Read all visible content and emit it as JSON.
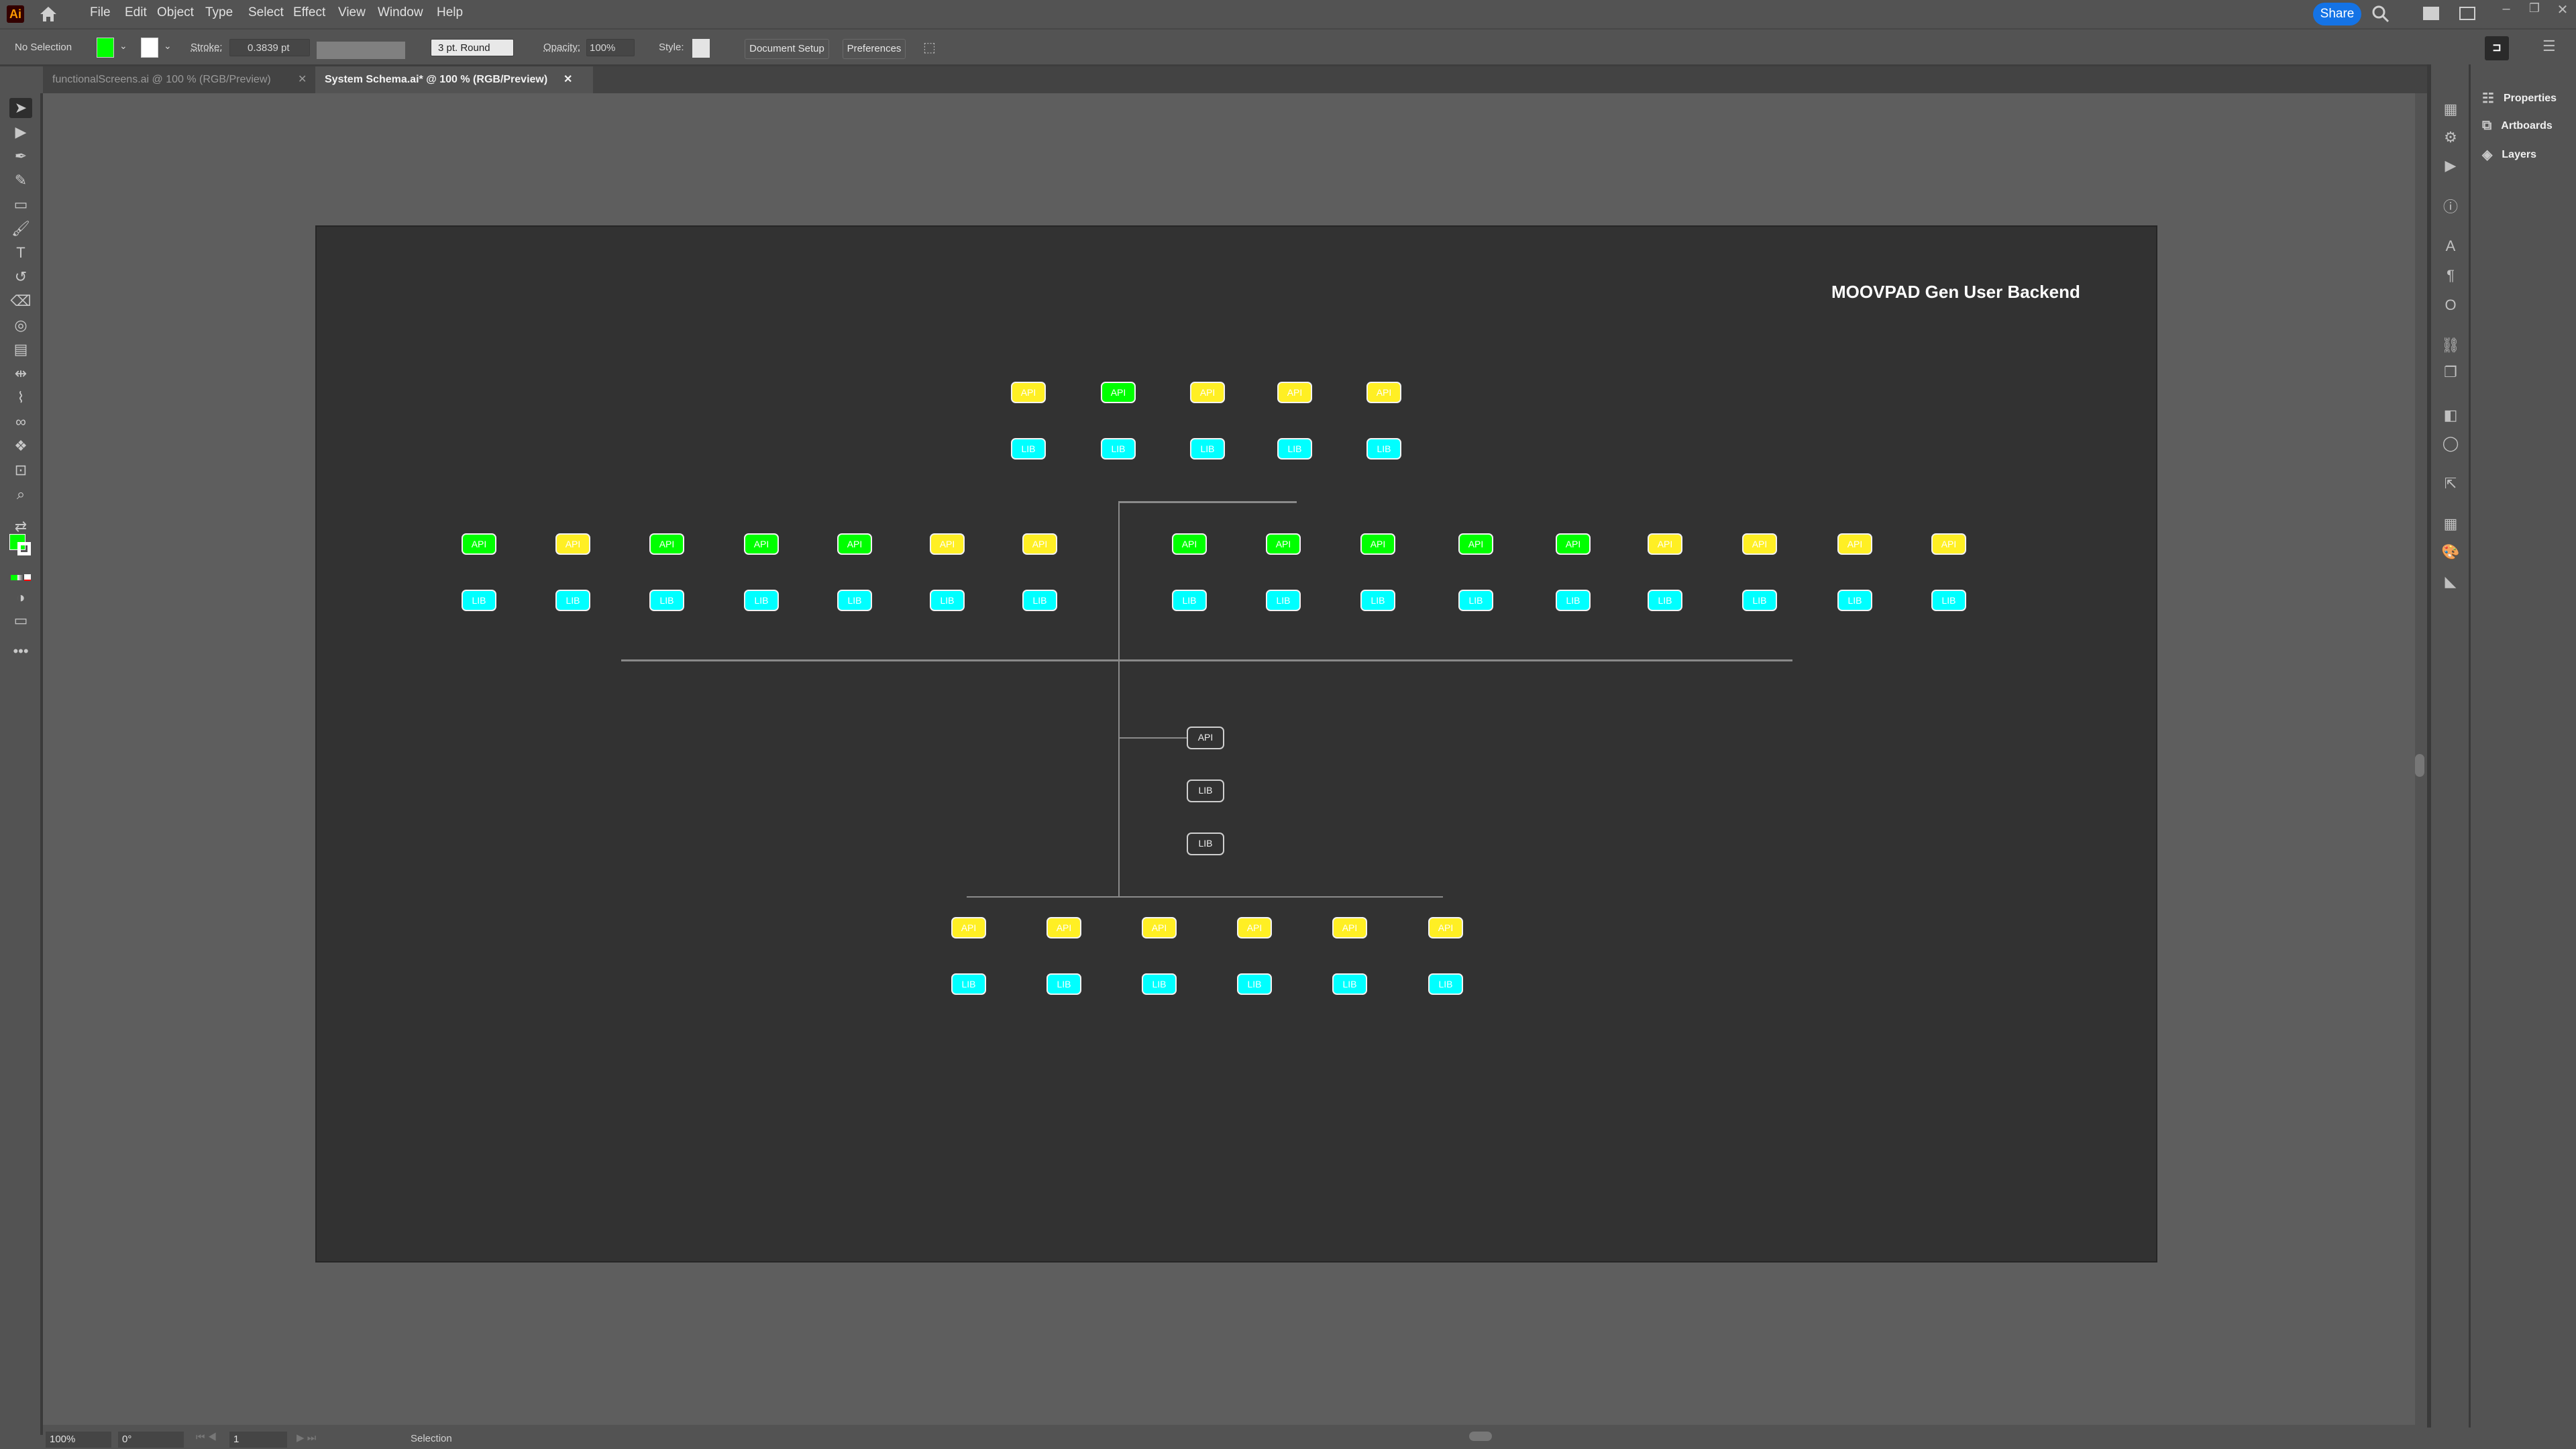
{
  "app": {
    "logo": "Ai",
    "share_label": "Share"
  },
  "menu": [
    "File",
    "Edit",
    "Object",
    "Type",
    "Select",
    "Effect",
    "View",
    "Window",
    "Help"
  ],
  "control_bar": {
    "selection_state": "No Selection",
    "fill_color": "#00ff00",
    "stroke_label": "Stroke:",
    "stroke_value": "0.3839 pt",
    "brush_label": "3 pt. Round",
    "opacity_label": "Opacity:",
    "opacity_value": "100%",
    "style_label": "Style:",
    "document_setup": "Document Setup",
    "preferences": "Preferences"
  },
  "tabs": [
    {
      "label": "functionalScreens.ai @ 100 % (RGB/Preview)",
      "active": false
    },
    {
      "label": "System Schema.ai* @ 100 % (RGB/Preview)",
      "active": true
    }
  ],
  "tools": [
    "selection",
    "direct-selection",
    "pen",
    "curvature",
    "rectangle",
    "paintbrush",
    "type",
    "rotate",
    "eraser",
    "shape-builder",
    "gradient",
    "width",
    "eyedropper",
    "blend",
    "symbol-sprayer",
    "artboard",
    "zoom"
  ],
  "right_panels": [
    "Properties",
    "Artboards",
    "Layers"
  ],
  "artboard": {
    "title": "MOOVPAD Gen User Backend",
    "colors": {
      "green": "#00ff00",
      "yellow": "#ffef24",
      "cyan": "#00ffff",
      "background": "#323232"
    },
    "top_group": {
      "api": [
        "yellow",
        "green",
        "yellow",
        "yellow",
        "yellow"
      ],
      "lib_count": 5
    },
    "left_group": {
      "api": [
        "green",
        "yellow",
        "green",
        "green",
        "green",
        "yellow",
        "yellow"
      ],
      "lib_count": 7
    },
    "right_group": {
      "api": [
        "green",
        "green",
        "green",
        "green",
        "green",
        "yellow",
        "yellow",
        "yellow",
        "yellow"
      ],
      "lib_count": 9
    },
    "center_group": [
      "API",
      "LIB",
      "LIB"
    ],
    "bottom_group": {
      "api": [
        "yellow",
        "yellow",
        "yellow",
        "yellow",
        "yellow",
        "yellow"
      ],
      "lib_count": 6
    },
    "api_label": "API",
    "lib_label": "LIB"
  },
  "status_bar": {
    "zoom": "100%",
    "rotation": "0°",
    "artboard_number": "1",
    "tool": "Selection"
  }
}
